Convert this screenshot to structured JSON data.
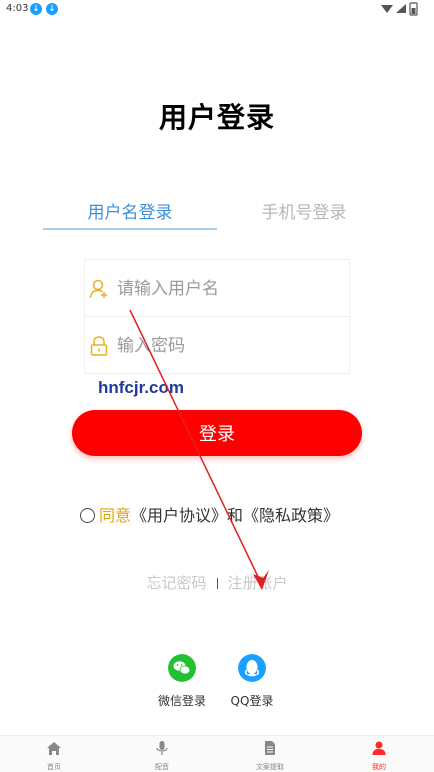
{
  "status_bar": {
    "time": "4:03"
  },
  "page": {
    "title": "用户登录"
  },
  "tabs": [
    {
      "label": "用户名登录",
      "active": true
    },
    {
      "label": "手机号登录",
      "active": false
    }
  ],
  "form": {
    "username_placeholder": "请输入用户名",
    "password_placeholder": "输入密码"
  },
  "watermark": "hnfcjr.com",
  "login_button": "登录",
  "agreement": {
    "agree_word": "同意",
    "user_agreement": "《用户协议》",
    "and": "和",
    "privacy_policy": "《隐私政策》"
  },
  "links": {
    "forgot_password": "忘记密码",
    "register": "注册账户"
  },
  "social": {
    "wechat_label": "微信登录",
    "qq_label": "QQ登录"
  },
  "bottom_nav": [
    {
      "label": "首页",
      "icon": "home-icon",
      "active": false
    },
    {
      "label": "配音",
      "icon": "microphone-icon",
      "active": false
    },
    {
      "label": "文案提取",
      "icon": "document-icon",
      "active": false
    },
    {
      "label": "我的",
      "icon": "person-icon",
      "active": true
    }
  ],
  "colors": {
    "accent_red": "#ff0000",
    "tab_active_blue": "#3d8fdc",
    "agree_yellow": "#e6a400",
    "wechat_green": "#22c033",
    "qq_blue": "#1aa0ff",
    "annotation_arrow": "#e02020"
  }
}
